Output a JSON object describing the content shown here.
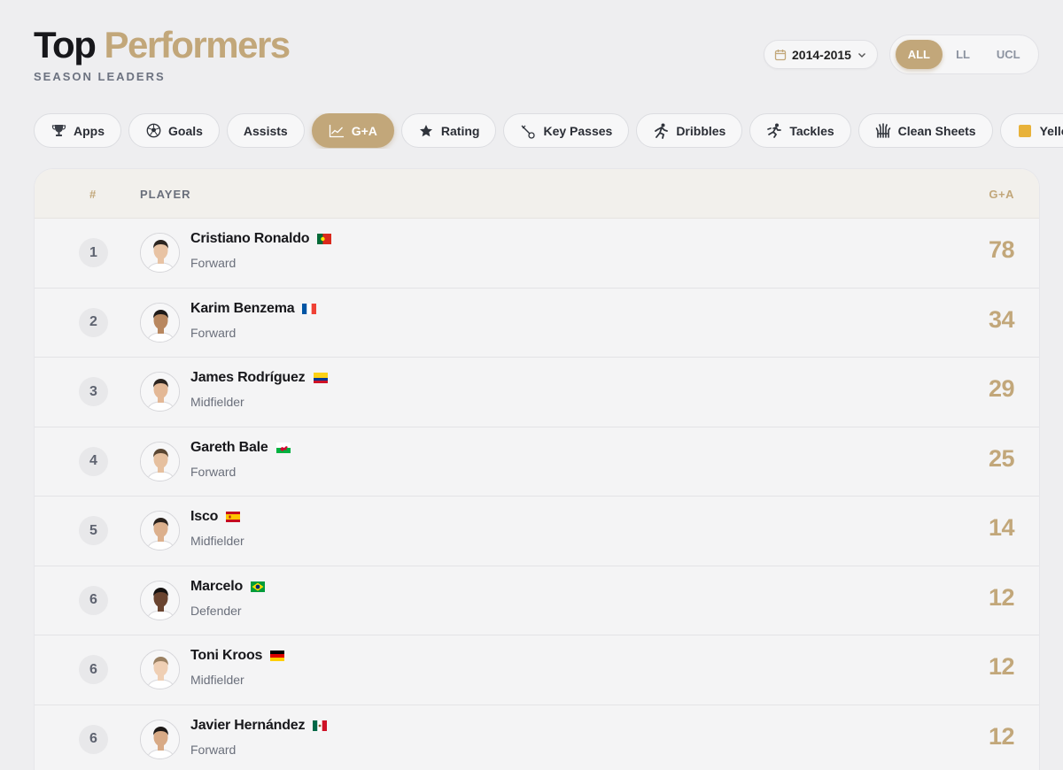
{
  "header": {
    "title_part1": "Top",
    "title_part2": "Performers",
    "subtitle": "SEASON LEADERS",
    "season": "2014-2015",
    "competitions": [
      "ALL",
      "LL",
      "UCL"
    ],
    "active_competition": "ALL"
  },
  "tabs": [
    {
      "label": "Apps",
      "icon": "trophy-icon"
    },
    {
      "label": "Goals",
      "icon": "soccer-ball-icon"
    },
    {
      "label": "Assists",
      "icon": ""
    },
    {
      "label": "G+A",
      "icon": "trend-chart-icon"
    },
    {
      "label": "Rating",
      "icon": "star-icon"
    },
    {
      "label": "Key Passes",
      "icon": "key-pass-icon"
    },
    {
      "label": "Dribbles",
      "icon": "runner-icon"
    },
    {
      "label": "Tackles",
      "icon": "tackle-icon"
    },
    {
      "label": "Clean Sheets",
      "icon": "glove-icon"
    },
    {
      "label": "Yellows",
      "icon": "yellow-card-icon"
    }
  ],
  "active_tab": "G+A",
  "table": {
    "col_rank": "#",
    "col_player": "PLAYER",
    "col_stat": "G+A",
    "rows": [
      {
        "rank": "1",
        "name": "Cristiano Ronaldo",
        "position": "Forward",
        "value": "78",
        "flag": "portugal"
      },
      {
        "rank": "2",
        "name": "Karim Benzema",
        "position": "Forward",
        "value": "34",
        "flag": "france"
      },
      {
        "rank": "3",
        "name": "James Rodríguez",
        "position": "Midfielder",
        "value": "29",
        "flag": "colombia"
      },
      {
        "rank": "4",
        "name": "Gareth Bale",
        "position": "Forward",
        "value": "25",
        "flag": "wales"
      },
      {
        "rank": "5",
        "name": "Isco",
        "position": "Midfielder",
        "value": "14",
        "flag": "spain"
      },
      {
        "rank": "6",
        "name": "Marcelo",
        "position": "Defender",
        "value": "12",
        "flag": "brazil"
      },
      {
        "rank": "6",
        "name": "Toni Kroos",
        "position": "Midfielder",
        "value": "12",
        "flag": "germany"
      },
      {
        "rank": "6",
        "name": "Javier Hernández",
        "position": "Forward",
        "value": "12",
        "flag": "mexico"
      }
    ]
  },
  "colors": {
    "accent": "#c2a77a",
    "background": "#eeeef0"
  }
}
